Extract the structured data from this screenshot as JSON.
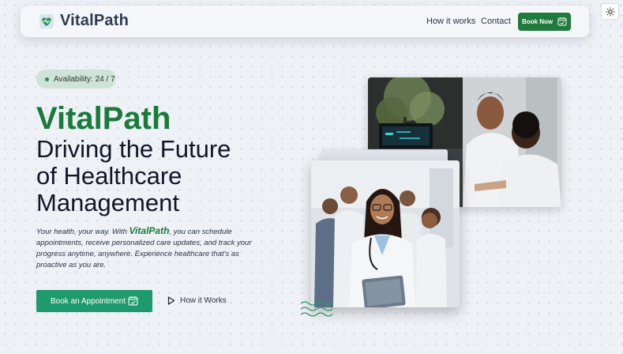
{
  "nav": {
    "brand": "VitalPath",
    "links": [
      "How it works",
      "Contact"
    ],
    "cta_label": "Book Now",
    "theme_toggle_icon": "sun-icon"
  },
  "hero": {
    "badge": "Availability: 24 / 7",
    "brand": "VitalPath",
    "title_lines": [
      "Driving the Future",
      "of Healthcare",
      "Management"
    ],
    "desc_pre": "Your health, your way. With ",
    "desc_brand": "VitalPath",
    "desc_post": ", you can schedule appointments, receive personalized care updates, and track your progress anytime, anywhere. Experience healthcare that's as proactive as you are.",
    "primary_cta": "Book an Appointment",
    "secondary_cta": "How it Works"
  },
  "colors": {
    "brand_green": "#1a7a3a",
    "cta_green": "#1f9a6e",
    "badge_bg": "#cfe3d6",
    "nav_cta": "#1f7a3c"
  }
}
